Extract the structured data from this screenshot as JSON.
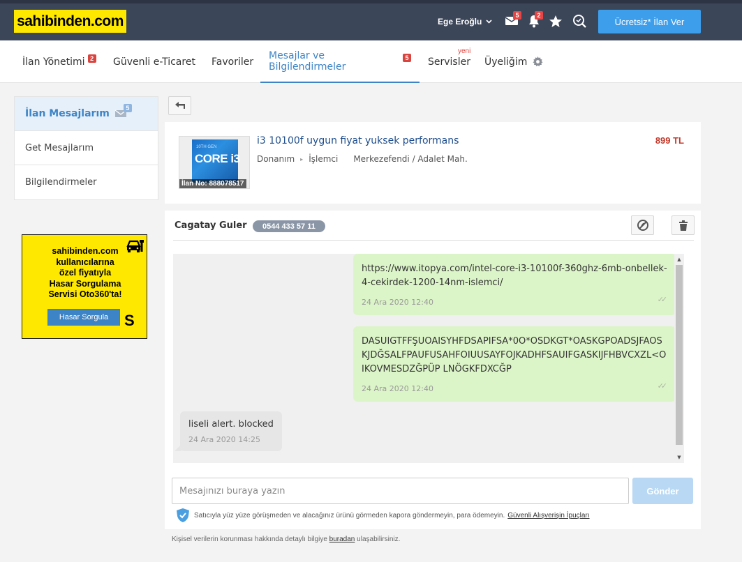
{
  "header": {
    "logo": "sahibinden.com",
    "user_name": "Ege Eroğlu",
    "mail_badge": "5",
    "bell_badge": "2",
    "cta": "Ücretsiz* İlan Ver"
  },
  "nav": {
    "tabs": [
      {
        "label": "İlan Yönetimi",
        "badge": "2"
      },
      {
        "label": "Güvenli e-Ticaret"
      },
      {
        "label": "Favoriler"
      },
      {
        "label": "Mesajlar ve Bilgilendirmeler",
        "badge": "5"
      },
      {
        "label": "Servisler",
        "tag": "yeni"
      },
      {
        "label": "Üyeliğim"
      }
    ]
  },
  "sidebar": {
    "items": [
      {
        "label": "İlan Mesajlarım",
        "badge": "5"
      },
      {
        "label": "Get Mesajlarım"
      },
      {
        "label": "Bilgilendirmeler"
      }
    ]
  },
  "ad": {
    "line1": "sahibinden.com",
    "line2": "kullanıcılarına",
    "line3": "özel fiyatıyla",
    "line4": "Hasar Sorgulama",
    "line5": "Servisi Oto360'ta!",
    "button": "Hasar Sorgula",
    "mark": "S"
  },
  "listing": {
    "title": "i3 10100f uygun fiyat yuksek performans",
    "price": "899 TL",
    "category": "Donanım",
    "subcategory": "İşlemci",
    "location": "Merkezefendi / Adalet Mah.",
    "id_caption": "İlan No: 888078517",
    "thumb_top": "10TH GEN",
    "thumb_text": "CORE i3"
  },
  "chat": {
    "user": "Cagatay Guler",
    "phone": "0544 433 57 11",
    "messages": [
      {
        "direction": "out",
        "text": "https://www.itopya.com/intel-core-i3-10100f-360ghz-6mb-onbellek-4-cekirdek-1200-14nm-islemci/",
        "time": "24 Ara 2020 12:40"
      },
      {
        "direction": "out",
        "text": "DASUIGTFFŞUOAISYHFDSAPIFSA*0O*OSDKGT*OASKGPOADSJFAOSKJDĞSALFPAUFUSAHFOIUUSAYFOJKADHFSAUIFGASKIJFHBVCXZL<OIKOVMESDZĞPÜP LNÖGKFDXCĞP",
        "time": "24 Ara 2020 12:40"
      },
      {
        "direction": "in",
        "text": "liseli alert. blocked",
        "time": "24 Ara 2020 14:25"
      }
    ],
    "input_placeholder": "Mesajınızı buraya yazın",
    "send": "Gönder",
    "warning": "Satıcıyla yüz yüze görüşmeden ve alacağınız ürünü görmeden kapora göndermeyin, para ödemeyin.",
    "warning_link": "Güvenli Alışverişin İpuçları"
  },
  "footer": {
    "privacy_before": "Kişisel verilerin korunması hakkında detaylı bilgiye",
    "privacy_link": "buradan",
    "privacy_after": "ulaşabilirsiniz."
  }
}
